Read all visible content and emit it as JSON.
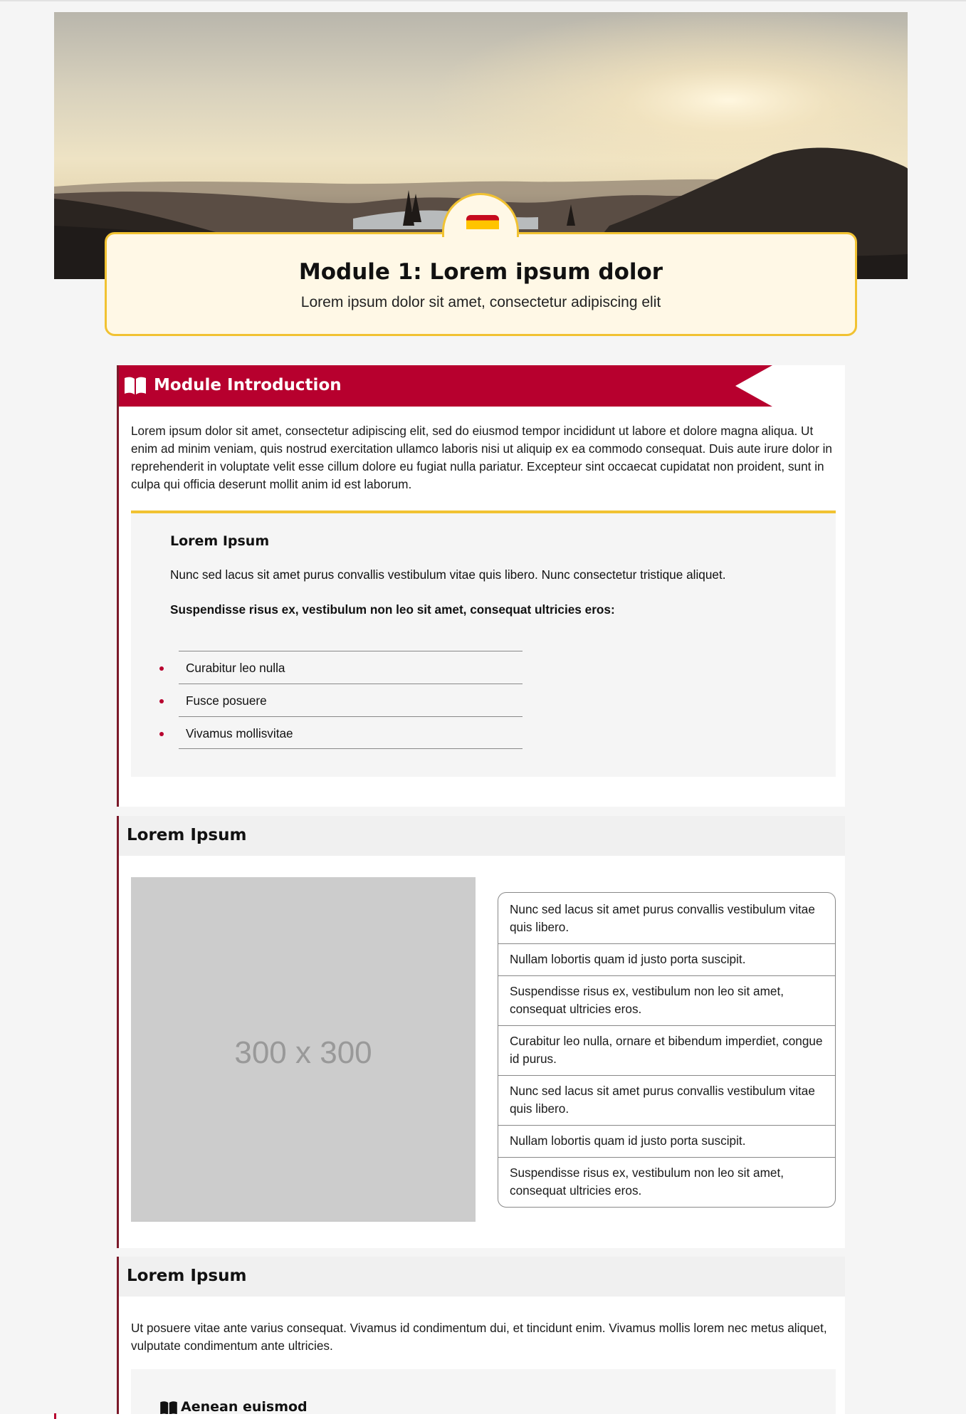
{
  "module": {
    "title": "Module 1: Lorem ipsum dolor",
    "subtitle": "Lorem ipsum dolor sit amet, consectetur adipiscing elit",
    "flag_icon": "spain-flag-icon"
  },
  "intro": {
    "title": "Module Introduction",
    "icon": "book-open-icon",
    "body": "Lorem ipsum dolor sit amet, consectetur adipiscing elit, sed do eiusmod tempor incididunt ut labore et dolore magna aliqua. Ut enim ad minim veniam, quis nostrud exercitation ullamco laboris nisi ut aliquip ex ea commodo consequat. Duis aute irure dolor in reprehenderit in voluptate velit esse cillum dolore eu fugiat nulla pariatur. Excepteur sint occaecat cupidatat non proident, sunt in culpa qui officia deserunt mollit anim id est laborum.",
    "callout": {
      "title": "Lorem Ipsum",
      "paragraph": "Nunc sed lacus sit amet purus convallis vestibulum vitae quis libero. Nunc consectetur tristique aliquet.",
      "lead": "Suspendisse risus ex, vestibulum non leo sit amet, consequat ultricies eros:",
      "bullets": [
        "Curabitur leo nulla",
        "Fusce posuere",
        "Vivamus mollisvitae"
      ]
    }
  },
  "section2": {
    "title": "Lorem Ipsum",
    "image_placeholder": "300 x 300",
    "items": [
      "Nunc sed lacus sit amet purus convallis vestibulum vitae quis libero.",
      "Nullam lobortis quam id justo porta suscipit.",
      "Suspendisse risus ex, vestibulum non leo sit amet, consequat ultricies eros.",
      "Curabitur leo nulla, ornare et bibendum imperdiet, congue id purus.",
      "Nunc sed lacus sit amet purus convallis vestibulum vitae quis libero.",
      "Nullam lobortis quam id justo porta suscipit.",
      "Suspendisse risus ex, vestibulum non leo sit amet, consequat ultricies eros."
    ]
  },
  "section3": {
    "title": "Lorem Ipsum",
    "body": "Ut posuere vitae ante varius consequat. Vivamus id condimentum dui, et tincidunt enim. Vivamus mollis lorem nec metus aliquet, vulputate condimentum ante ultricies.",
    "sub_title": "Aenean euismod",
    "sub_icon": "book-open-icon"
  },
  "colors": {
    "accent_red": "#b7002e",
    "accent_yellow": "#f1c232",
    "card_bg": "#fff8e6"
  }
}
